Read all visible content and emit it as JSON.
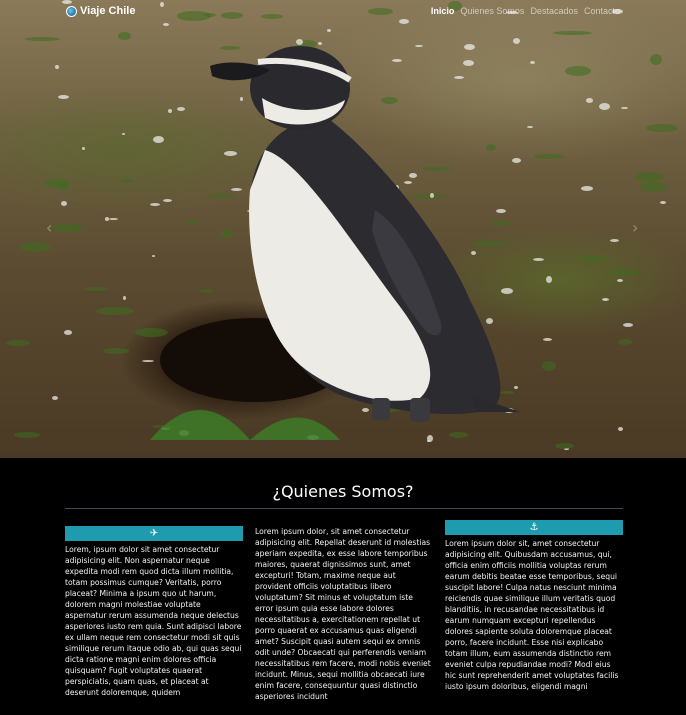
{
  "nav": {
    "brand": "Viaje Chile",
    "brand_icon": "globe-icon",
    "links": [
      {
        "label": "Inicio",
        "active": true
      },
      {
        "label": "Quienes Somos",
        "active": false
      },
      {
        "label": "Destacados",
        "active": false
      },
      {
        "label": "Contacto",
        "active": false
      }
    ]
  },
  "hero": {
    "image": "penguin-photo",
    "prev_arrow": "‹",
    "next_arrow": "›"
  },
  "about": {
    "title": "¿Quienes Somos?",
    "columns": [
      {
        "icon": "airplane-icon",
        "glyph": "✈",
        "text": "Lorem, ipsum dolor sit amet consectetur adipisicing elit. Non aspernatur neque expedita modi rem quod dicta illum mollitia, totam possimus cumque? Veritatis, porro placeat? Minima a ipsum quo ut harum, dolorem magni molestiae voluptate aspernatur rerum assumenda neque delectus asperiores iusto rem quia. Sunt adipisci labore ex ullam neque rem consectetur modi sit quis similique rerum itaque odio ab, qui quas sequi dicta ratione magni enim dolores officia quisquam? Fugit voluptates quaerat perspiciatis, quam quas, et placeat at deserunt doloremque, quidem"
      },
      {
        "icon": "",
        "glyph": "",
        "text": "Lorem ipsum dolor, sit amet consectetur adipisicing elit. Repellat deserunt id molestias aperiam expedita, ex esse labore temporibus maiores, quaerat dignissimos sunt, amet excepturi! Totam, maxime neque aut provident officiis voluptatibus libero voluptatum? Sit minus et voluptatum iste error ipsum quia esse labore dolores necessitatibus a, exercitationem repellat ut porro quaerat ex accusamus quas eligendi amet? Suscipit quasi autem sequi ex omnis odit unde? Obcaecati qui perferendis veniam necessitatibus rem facere, modi nobis eveniet incidunt. Minus, sequi mollitia obcaecati iure enim facere, consequuntur quasi distinctio asperiores incidunt"
      },
      {
        "icon": "anchor-icon",
        "glyph": "⚓",
        "text": "Lorem ipsum dolor sit, amet consectetur adipisicing elit. Quibusdam accusamus, qui, officia enim officiis mollitia voluptas rerum earum debitis beatae esse temporibus, sequi suscipit labore! Culpa natus nesciunt minima reiciendis quae similique illum veritatis quod blanditiis, in recusandae necessitatibus id earum numquam excepturi repellendus dolores sapiente soluta doloremque placeat porro, facere incidunt. Esse nisi explicabo totam illum, eum assumenda distinctio rem eveniet culpa repudiandae modi? Modi eius hic sunt reprehenderit amet voluptates facilis iusto ipsum doloribus, eligendi magni"
      }
    ]
  }
}
